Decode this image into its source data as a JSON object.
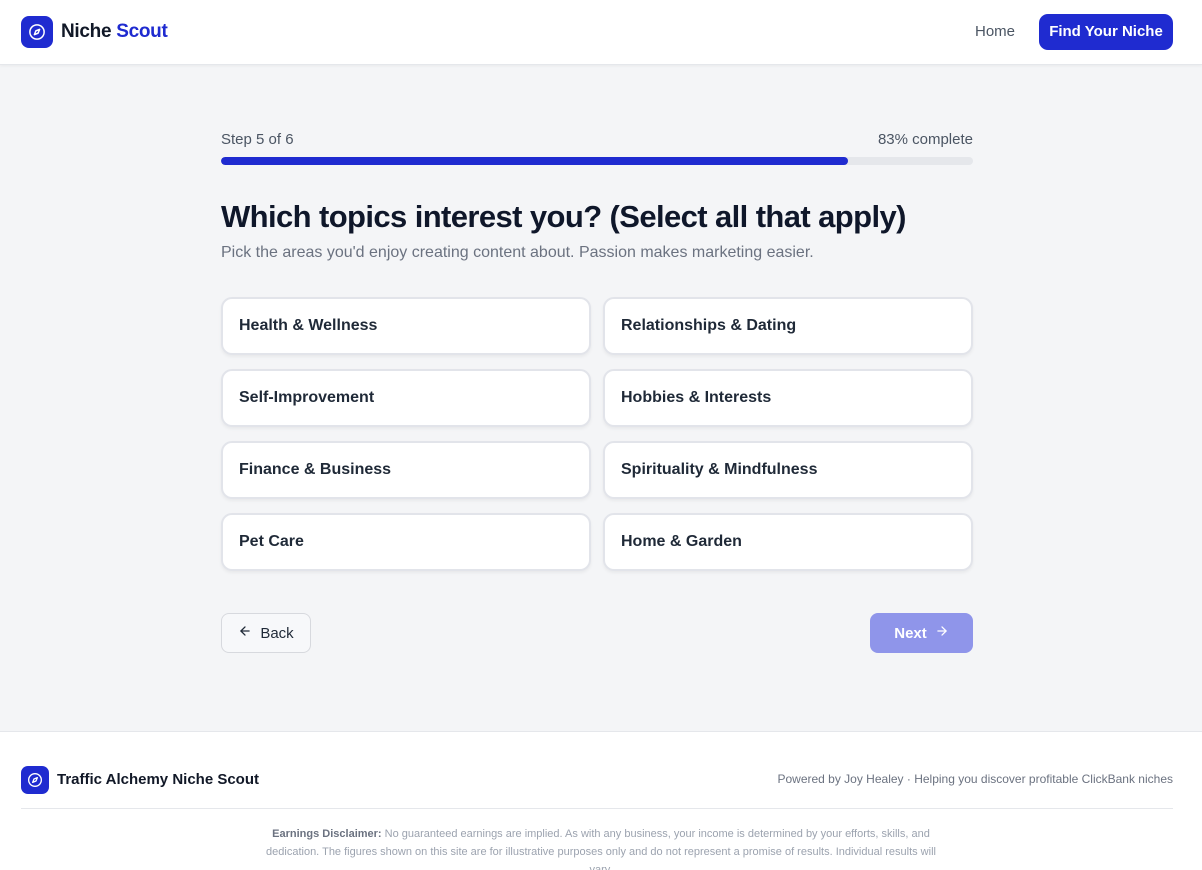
{
  "header": {
    "brand_primary": "Niche",
    "brand_accent": "Scout",
    "nav_home": "Home",
    "cta_label": "Find Your Niche",
    "logo_icon": "compass-icon"
  },
  "progress": {
    "step_label": "Step 5 of 6",
    "percent_label": "83% complete",
    "fraction": 0.834
  },
  "question": {
    "title": "Which topics interest you? (Select all that apply)",
    "subtitle": "Pick the areas you'd enjoy creating content about. Passion makes marketing easier."
  },
  "options": [
    "Health & Wellness",
    "Relationships & Dating",
    "Self-Improvement",
    "Hobbies & Interests",
    "Finance & Business",
    "Spirituality & Mindfulness",
    "Pet Care",
    "Home & Garden"
  ],
  "navigation": {
    "back_label": "Back",
    "next_label": "Next",
    "back_icon": "arrow-left-icon",
    "next_icon": "arrow-right-icon"
  },
  "footer": {
    "brand": "Traffic Alchemy Niche Scout",
    "powered": "Powered by Joy Healey · Helping you discover profitable ClickBank niches",
    "disclaimer_label": "Earnings Disclaimer:",
    "disclaimer_text": "No guaranteed earnings are implied. As with any business, your income is determined by your efforts, skills, and dedication. The figures shown on this site are for illustrative purposes only and do not represent a promise of results. Individual results will vary."
  },
  "colors": {
    "accent": "#1f2bd0",
    "next_disabled": "#8f95ea",
    "page_bg": "#f4f5f7"
  }
}
